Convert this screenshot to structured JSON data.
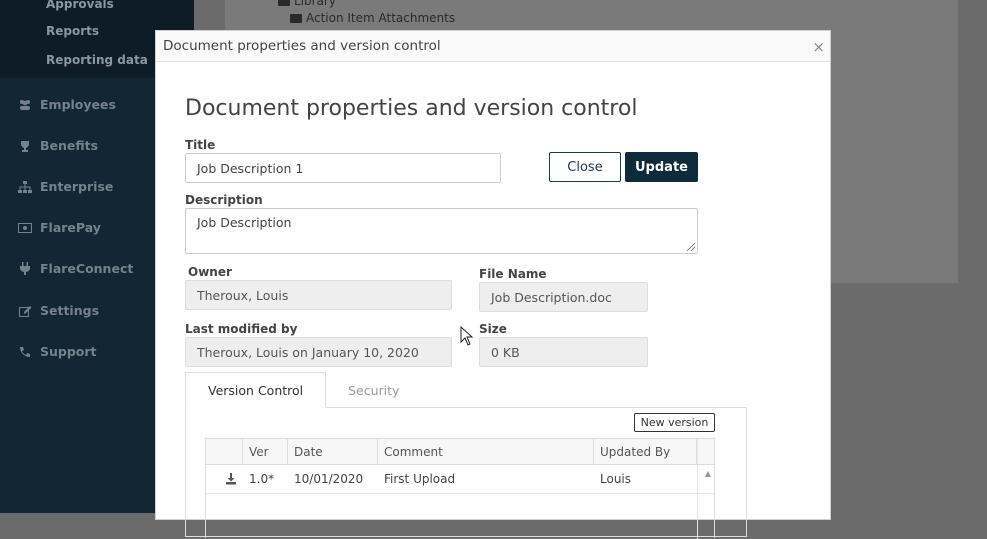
{
  "sidebar": {
    "sub_items": [
      "Approvals",
      "Reports",
      "Reporting data"
    ],
    "items": [
      {
        "label": "Employees",
        "icon": "users-icon"
      },
      {
        "label": "Benefits",
        "icon": "trophy-icon"
      },
      {
        "label": "Enterprise",
        "icon": "sitemap-icon"
      },
      {
        "label": "FlarePay",
        "icon": "money-icon"
      },
      {
        "label": "FlareConnect",
        "icon": "plug-icon"
      },
      {
        "label": "Settings",
        "icon": "edit-icon"
      },
      {
        "label": "Support",
        "icon": "phone-icon"
      }
    ]
  },
  "background": {
    "library_label": "Library",
    "folder_label": "Action Item Attachments"
  },
  "modal": {
    "header_title": "Document properties and version control",
    "close_glyph": "×",
    "heading": "Document properties and version control",
    "title_label": "Title",
    "title_value": "Job Description 1",
    "close_button": "Close",
    "update_button": "Update",
    "description_label": "Description",
    "description_value": "Job Description",
    "owner_label": "Owner",
    "owner_value": "Theroux, Louis",
    "file_name_label": "File Name",
    "file_name_value": "Job Description.doc",
    "last_modified_label": "Last modified by",
    "last_modified_value": "Theroux, Louis on January 10, 2020",
    "size_label": "Size",
    "size_value": "0 KB",
    "tabs": [
      "Version Control",
      "Security"
    ],
    "new_version_button": "New version",
    "grid": {
      "headers": [
        "",
        "Ver",
        "Date",
        "Comment",
        "Updated By"
      ],
      "rows": [
        {
          "ver": "1.0*",
          "date": "10/01/2020",
          "comment": "First Upload",
          "updated_by": "Louis"
        }
      ]
    }
  },
  "colors": {
    "sidebar_bg": "#132633",
    "primary_button": "#0e2b3c"
  }
}
